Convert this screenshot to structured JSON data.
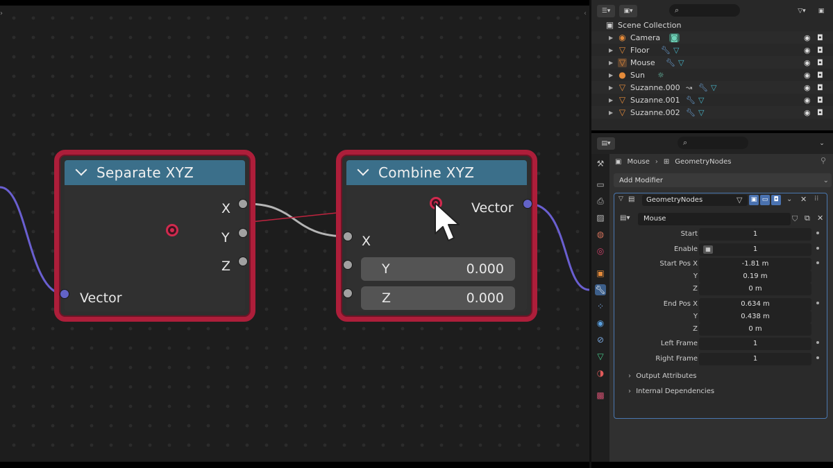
{
  "node_editor": {
    "separate_node": {
      "title": "Separate XYZ",
      "outputs": [
        "X",
        "Y",
        "Z"
      ],
      "input_label": "Vector"
    },
    "combine_node": {
      "title": "Combine XYZ",
      "output_label": "Vector",
      "input_x": "X",
      "input_y": {
        "label": "Y",
        "value": "0.000"
      },
      "input_z": {
        "label": "Z",
        "value": "0.000"
      }
    },
    "colors": {
      "selected_frame": "#ad1e3a",
      "header": "#3b6f8a",
      "vector_socket": "#6363c7",
      "float_socket": "#a1a1a1",
      "drag_wire": "#d12a4e"
    }
  },
  "outliner": {
    "root": "Scene Collection",
    "items": [
      {
        "name": "Camera",
        "icon": "camera-icon",
        "mods": "camera-data-icon"
      },
      {
        "name": "Floor",
        "icon": "mesh-icon",
        "mods": "wrench-icon mesh-data-icon"
      },
      {
        "name": "Mouse",
        "icon": "mesh-icon",
        "mods": "wrench-icon mesh-data-icon"
      },
      {
        "name": "Sun",
        "icon": "light-icon",
        "mods": "sun-data-icon"
      },
      {
        "name": "Suzanne.000",
        "icon": "mesh-icon",
        "mods": "constraint-icon wrench-icon mesh-data-icon"
      },
      {
        "name": "Suzanne.001",
        "icon": "mesh-icon",
        "mods": "wrench-icon mesh-data-icon"
      },
      {
        "name": "Suzanne.002",
        "icon": "mesh-icon",
        "mods": "wrench-icon mesh-data-icon"
      }
    ]
  },
  "properties": {
    "breadcrumb": {
      "object": "Mouse",
      "modifier": "GeometryNodes"
    },
    "add_modifier": "Add Modifier",
    "modifier": {
      "name": "GeometryNodes",
      "node_group": "Mouse",
      "fields": [
        {
          "label": "Start",
          "value": "1"
        },
        {
          "label": "Enable",
          "value": "1"
        },
        {
          "label": "Start Pos X",
          "value": "-1.81 m"
        },
        {
          "label": "Y",
          "value": "0.19 m"
        },
        {
          "label": "Z",
          "value": "0 m"
        },
        {
          "label": "End Pos X",
          "value": "0.634 m"
        },
        {
          "label": "Y",
          "value": "0.438 m"
        },
        {
          "label": "Z",
          "value": "0 m"
        },
        {
          "label": "Left Frame",
          "value": "1"
        },
        {
          "label": "Right Frame",
          "value": "1"
        }
      ],
      "sections": [
        "Output Attributes",
        "Internal Dependencies"
      ]
    }
  }
}
